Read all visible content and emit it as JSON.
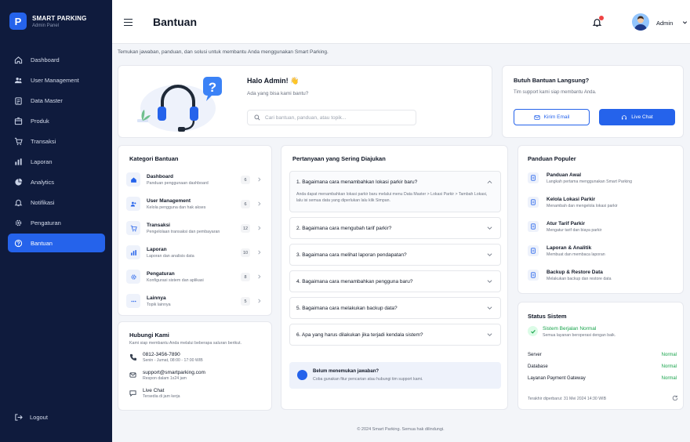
{
  "brand": {
    "logo_letter": "P",
    "name": "SMART PARKING",
    "sub": "Admin Panel"
  },
  "sidebar": {
    "items": [
      {
        "label": "Dashboard",
        "icon": "home-icon"
      },
      {
        "label": "User Management",
        "icon": "users-icon"
      },
      {
        "label": "Data Master",
        "icon": "clipboard-icon"
      },
      {
        "label": "Produk",
        "icon": "box-icon"
      },
      {
        "label": "Transaksi",
        "icon": "cart-icon"
      },
      {
        "label": "Laporan",
        "icon": "bar-chart-icon"
      },
      {
        "label": "Analytics",
        "icon": "pie-chart-icon"
      },
      {
        "label": "Notifikasi",
        "icon": "bell-icon"
      },
      {
        "label": "Pengaturan",
        "icon": "gear-icon"
      },
      {
        "label": "Bantuan",
        "icon": "help-circle-icon",
        "active": true
      }
    ],
    "logout": "Logout"
  },
  "header": {
    "title": "Bantuan",
    "user": "Admin"
  },
  "subtitle": "Temukan jawaban, panduan, dan solusi untuk membantu Anda menggunakan Smart Parking.",
  "hero": {
    "title": "Halo Admin! 👋",
    "sub": "Ada yang bisa kami bantu?",
    "search_placeholder": "Cari bantuan, panduan, atau topik..."
  },
  "help": {
    "title": "Butuh Bantuan Langsung?",
    "sub": "Tim support kami siap membantu Anda.",
    "email_button": "Kirim Email",
    "chat_button": "Live Chat"
  },
  "categories": {
    "title": "Kategori Bantuan",
    "items": [
      {
        "name": "Dashboard",
        "desc": "Panduan penggunaan dashboard",
        "count": "6",
        "icon": "home-icon"
      },
      {
        "name": "User Management",
        "desc": "Kelola pengguna dan hak akses",
        "count": "6",
        "icon": "users-icon"
      },
      {
        "name": "Transaksi",
        "desc": "Pengelolaan transaksi dan pembayaran",
        "count": "12",
        "icon": "cart-icon"
      },
      {
        "name": "Laporan",
        "desc": "Laporan dan analisis data",
        "count": "10",
        "icon": "bar-chart-icon"
      },
      {
        "name": "Pengaturan",
        "desc": "Konfigurasi sistem dan aplikasi",
        "count": "8",
        "icon": "gear-icon"
      },
      {
        "name": "Lainnya",
        "desc": "Topik lainnya",
        "count": "5",
        "icon": "more-icon"
      }
    ]
  },
  "contact": {
    "title": "Hubungi Kami",
    "sub": "Kami siap membantu Anda melalui beberapa saluran berikut.",
    "phone": "0812-3456-7890",
    "phone_hours": "Senin - Jumat, 08:00 - 17:00 WIB",
    "email": "support@smartparking.com",
    "email_note": "Respon dalam 1x24 jam",
    "chat": "Live Chat",
    "chat_note": "Tersedia di jam kerja"
  },
  "faq": {
    "title": "Pertanyaan yang Sering Diajukan",
    "items": [
      {
        "q": "1. Bagaimana cara menambahkan lokasi parkir baru?",
        "a": "Anda dapat menambahkan lokasi parkir baru melalui menu Data Master > Lokasi Parkir > Tambah Lokasi, lalu isi semua data yang diperlukan lalu klik Simpan.",
        "open": true
      },
      {
        "q": "2. Bagaimana cara mengubah tarif parkir?"
      },
      {
        "q": "3. Bagaimana cara melihat laporan pendapatan?"
      },
      {
        "q": "4. Bagaimana cara menambahkan pengguna baru?"
      },
      {
        "q": "5. Bagaimana cara melakukan backup data?"
      },
      {
        "q": "6. Apa yang harus dilakukan jika terjadi kendala sistem?"
      }
    ],
    "note_title": "Belum menemukan jawaban?",
    "note_sub": "Coba gunakan fitur pencarian atau hubungi tim support kami."
  },
  "popular": {
    "title": "Panduan Populer",
    "items": [
      {
        "name": "Panduan Awal",
        "desc": "Langkah pertama menggunakan Smart Parking"
      },
      {
        "name": "Kelola Lokasi Parkir",
        "desc": "Menambah dan mengelola lokasi parkir"
      },
      {
        "name": "Atur Tarif Parkir",
        "desc": "Mengatur tarif dan biaya parkir"
      },
      {
        "name": "Laporan & Analitik",
        "desc": "Membuat dan membaca laporan"
      },
      {
        "name": "Backup & Restore Data",
        "desc": "Melakukan backup dan restore data"
      }
    ]
  },
  "status": {
    "title": "Status Sistem",
    "ok_title": "Sistem Berjalan Normal",
    "ok_sub": "Semua layanan beroperasi dengan baik.",
    "rows": [
      {
        "name": "Server",
        "value": "Normal"
      },
      {
        "name": "Database",
        "value": "Normal"
      },
      {
        "name": "Layanan Payment Gateway",
        "value": "Normal"
      }
    ],
    "updated": "Terakhir diperbarui: 31 Mei 2024 14:30 WIB"
  },
  "footer": "© 2024 Smart Parking. Semua hak dilindungi.",
  "colors": {
    "sidebar": "#0f1b3d",
    "accent": "#2563eb",
    "ok": "#16a34a"
  }
}
